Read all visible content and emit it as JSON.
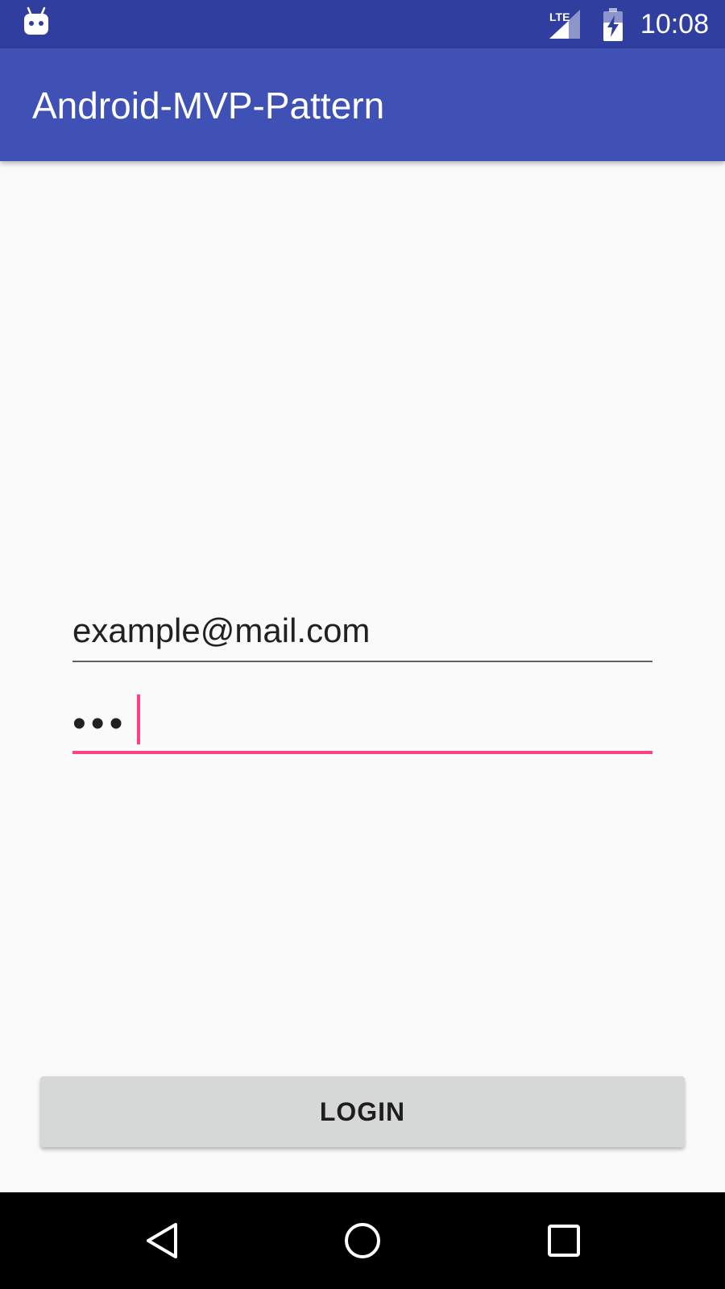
{
  "status_bar": {
    "network_label": "LTE",
    "time": "10:08",
    "icons": [
      "android-notification-icon",
      "lte-signal-icon",
      "battery-charging-icon"
    ]
  },
  "app_bar": {
    "title": "Android-MVP-Pattern"
  },
  "form": {
    "email_value": "example@mail.com",
    "password_value": "•••"
  },
  "login_button": {
    "label": "LOGIN"
  },
  "nav_bar": {
    "icons": [
      "back-icon",
      "home-icon",
      "recents-icon"
    ]
  },
  "colors": {
    "status_bar": "#303f9f",
    "app_bar": "#3f51b5",
    "accent": "#ff4081",
    "background": "#fafafa",
    "button": "#d6d7d7",
    "nav_bar": "#000000"
  }
}
